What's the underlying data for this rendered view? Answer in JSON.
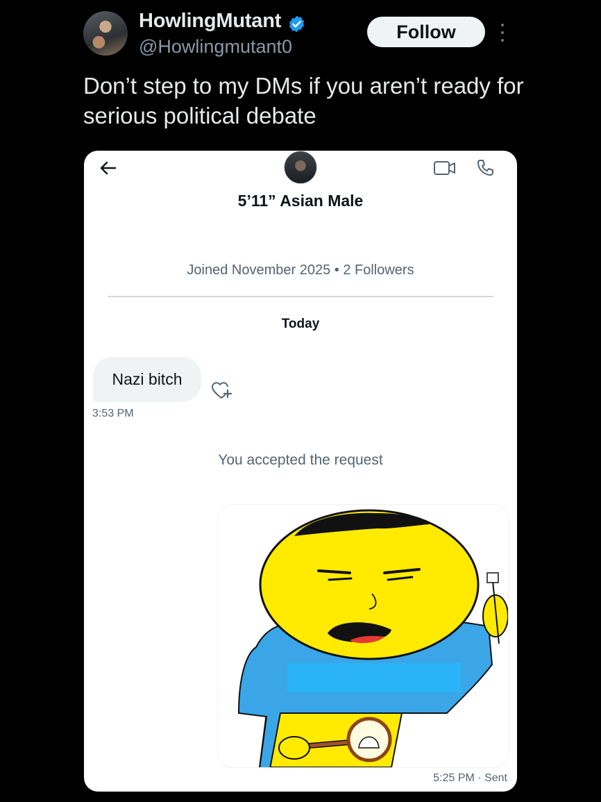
{
  "tweet": {
    "display_name": "HowlingMutant",
    "handle": "@Howlingmutant0",
    "follow_label": "Follow",
    "text": "Don’t step to my DMs if you aren’t ready for serious political debate",
    "verified_color": "#1d9bf0"
  },
  "dm": {
    "name": "5’11” Asian Male",
    "joined": "Joined November 2025 • 2 Followers",
    "date_divider": "Today",
    "messages": [
      {
        "text": "Nazi bitch",
        "time": "3:53 PM",
        "direction": "received"
      }
    ],
    "system_note": "You accepted the request",
    "sent": {
      "content": "cartoon-image",
      "time": "5:25 PM · Sent"
    },
    "icons": [
      "back-arrow-icon",
      "video-call-icon",
      "phone-call-icon",
      "add-reaction-icon"
    ]
  },
  "colors": {
    "background": "#000000",
    "card": "#ffffff",
    "bubble": "#eff3f4",
    "cartoon_face": "#ffea00",
    "cartoon_shirt": "#3aa6e8"
  }
}
